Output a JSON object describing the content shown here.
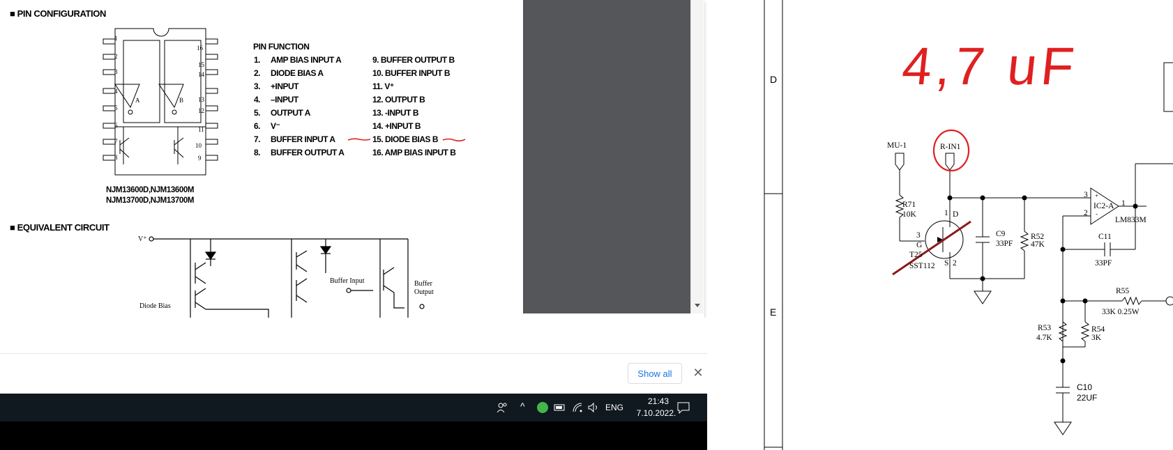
{
  "pdf": {
    "pin_config_title": "■ PIN CONFIGURATION",
    "pin_function_title": "PIN FUNCTION",
    "pins_left": [
      {
        "num": "1.",
        "label": "AMP BIAS INPUT A"
      },
      {
        "num": "2.",
        "label": "DIODE BIAS A"
      },
      {
        "num": "3.",
        "label": "+INPUT"
      },
      {
        "num": "4.",
        "label": "–INPUT"
      },
      {
        "num": "5.",
        "label": "OUTPUT A"
      },
      {
        "num": "6.",
        "label": "V⁻"
      },
      {
        "num": "7.",
        "label": "BUFFER INPUT A"
      },
      {
        "num": "8.",
        "label": "BUFFER OUTPUT A"
      }
    ],
    "pins_right": [
      "9. BUFFER OUTPUT B",
      "10. BUFFER INPUT B",
      "11. V⁺",
      "12. OUTPUT B",
      "13. -INPUT B",
      "14. +INPUT B",
      "15. DIODE BIAS B",
      "16. AMP BIAS INPUT B"
    ],
    "model_line1": "NJM13600D,NJM13600M",
    "model_line2": "NJM13700D,NJM13700M",
    "equiv_title": "■ EQUIVALENT CIRCUIT",
    "ic_pin_numbers_left": [
      "1",
      "2",
      "3",
      "4",
      "5",
      "6",
      "7",
      "8"
    ],
    "ic_pin_numbers_right": [
      "16",
      "15",
      "14",
      "13",
      "12",
      "11",
      "10",
      "9"
    ],
    "amp_a_label": "A",
    "amp_b_label": "B",
    "circuit_labels": {
      "vplus": "V⁺",
      "diode_bias": "Diode Bias",
      "buffer_input": "Buffer Input",
      "buffer_output_1": "Buffer",
      "buffer_output_2": "Output"
    }
  },
  "shelf": {
    "show_all": "Show all",
    "close": "✕"
  },
  "taskbar": {
    "language": "ENG",
    "time": "21:43",
    "date": "7.10.2022."
  },
  "schematic": {
    "row_d": "D",
    "row_e": "E",
    "handwritten_note": "4,7 uF",
    "mu1": "MU-1",
    "rin1": "R-IN1",
    "r71": "R71",
    "r71_val": "10K",
    "t_label": "T25",
    "t_part": "SST112",
    "pin_g": "G",
    "pin_3": "3",
    "pin_1": "1",
    "pin_d": "D",
    "pin_s": "S",
    "pin_2": "2",
    "c9": "C9",
    "c9_val": "33PF",
    "r52": "R52",
    "r52_val": "47K",
    "ic_label": "IC2-A",
    "ic_part": "LM833M",
    "ic_pin3": "3",
    "ic_pin2": "2",
    "ic_pin1": "1",
    "ic_plus": "+",
    "ic_minus": "-",
    "c11": "C11",
    "c11_val": "33PF",
    "r55": "R55",
    "r55_val": "33K 0.25W",
    "r53": "R53",
    "r53_val": "4.7K",
    "r54": "R54",
    "r54_val": "3K",
    "c10": "C10",
    "c10_val": "22UF"
  }
}
